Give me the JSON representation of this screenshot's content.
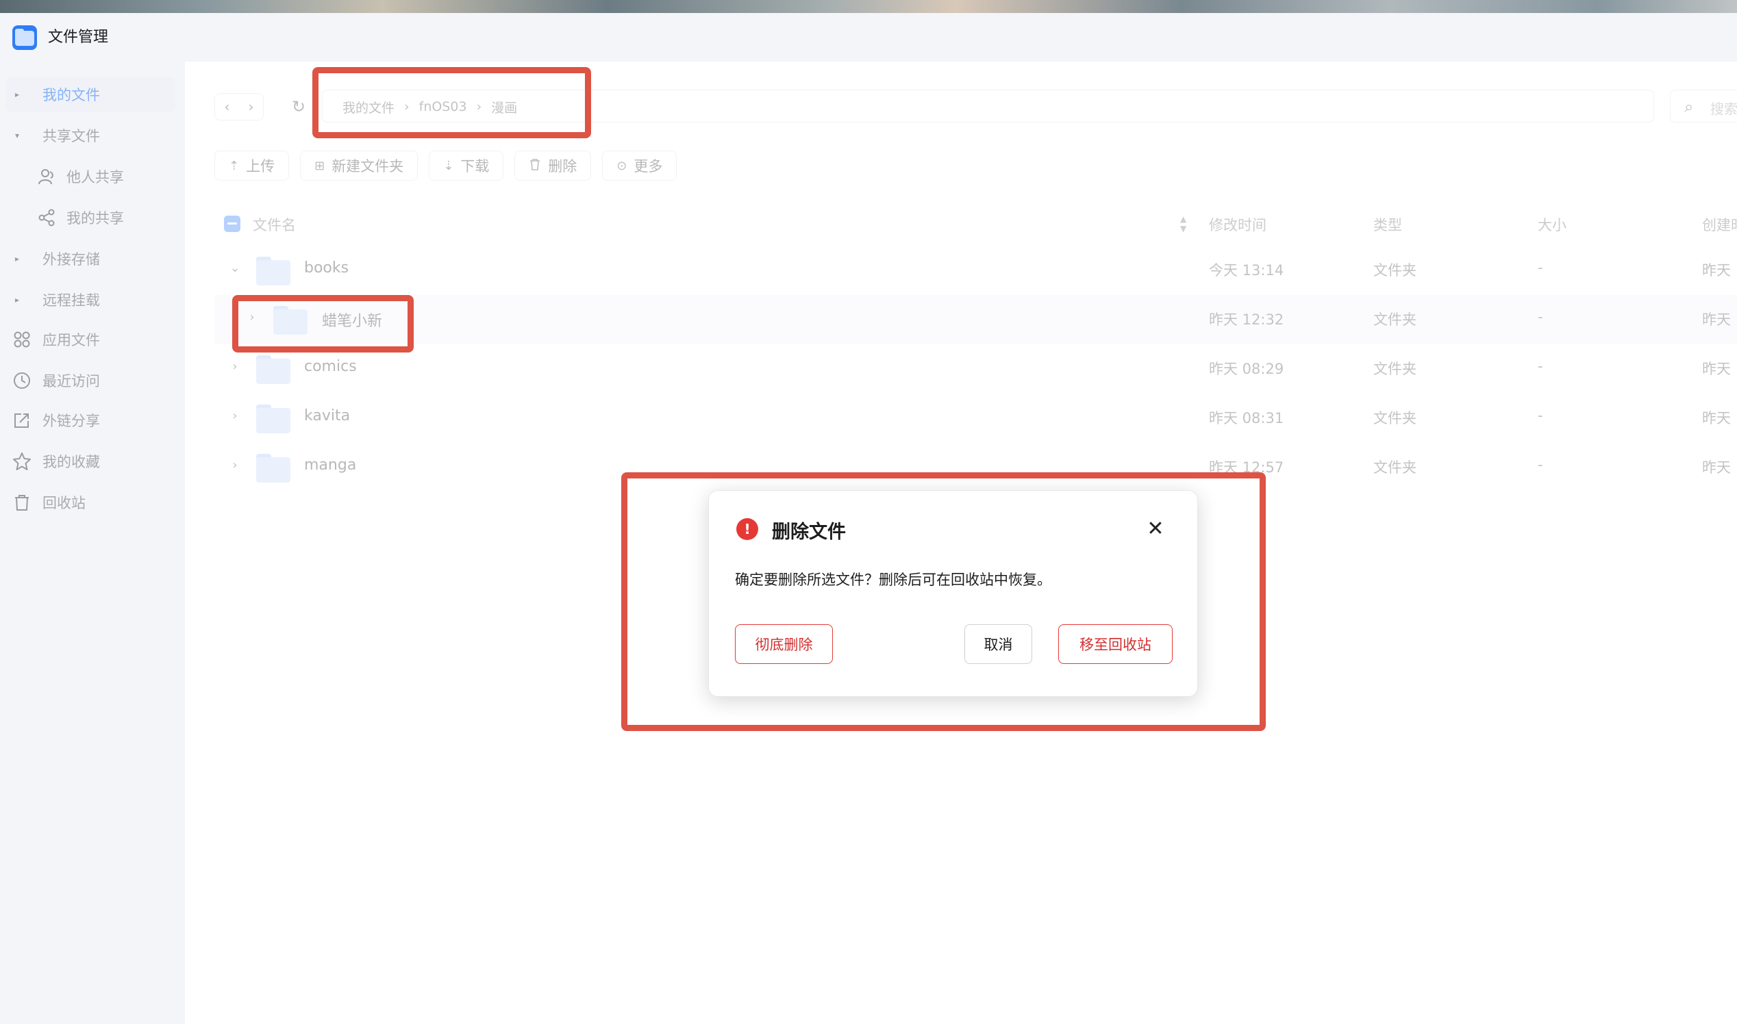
{
  "app": {
    "title": "文件管理",
    "accent_color": "#2f7df6",
    "icon": "folder-app-icon"
  },
  "sidebar": {
    "items": [
      {
        "label": "我的文件",
        "icon": "caret-right-icon",
        "active": true
      },
      {
        "label": "共享文件",
        "icon": "caret-down-icon"
      },
      {
        "label": "他人共享",
        "icon": "user-icon"
      },
      {
        "label": "我的共享",
        "icon": "share-icon"
      },
      {
        "label": "外接存储",
        "icon": "caret-right-icon"
      },
      {
        "label": "远程挂载",
        "icon": "caret-right-icon"
      },
      {
        "label": "应用文件",
        "icon": "grid-icon"
      },
      {
        "label": "最近访问",
        "icon": "clock-icon"
      },
      {
        "label": "外链分享",
        "icon": "external-share-icon"
      },
      {
        "label": "我的收藏",
        "icon": "star-icon"
      },
      {
        "label": "回收站",
        "icon": "trash-icon"
      }
    ]
  },
  "nav": {
    "back_glyph": "‹",
    "forward_glyph": "›",
    "refresh_glyph": "↻",
    "breadcrumb": [
      "我的文件",
      "fnOS03",
      "漫画"
    ],
    "breadcrumb_sep": "›",
    "search_placeholder": "搜索",
    "search_glyph": "⌕"
  },
  "toolbar": {
    "buttons": [
      {
        "label": "上传",
        "icon": "upload-icon",
        "glyph": "⇡"
      },
      {
        "label": "新建文件夹",
        "icon": "new-folder-icon",
        "glyph": "⊞"
      },
      {
        "label": "下载",
        "icon": "download-icon",
        "glyph": "⇣"
      },
      {
        "label": "删除",
        "icon": "trash-icon",
        "glyph": "🗑"
      },
      {
        "label": "更多",
        "icon": "more-icon",
        "glyph": "⊙"
      }
    ]
  },
  "table": {
    "headers": {
      "name": "文件名",
      "modified": "修改时间",
      "type": "类型",
      "size": "大小",
      "created": "创建时"
    },
    "rows": [
      {
        "name": "books",
        "modified": "今天 13:14",
        "type": "文件夹",
        "size": "-",
        "created": "昨天",
        "caret": "⌄"
      },
      {
        "name": "蜡笔小新",
        "modified": "昨天 12:32",
        "type": "文件夹",
        "size": "-",
        "created": "昨天",
        "caret": "›"
      },
      {
        "name": "comics",
        "modified": "昨天 08:29",
        "type": "文件夹",
        "size": "-",
        "created": "昨天",
        "caret": "›"
      },
      {
        "name": "kavita",
        "modified": "昨天 08:31",
        "type": "文件夹",
        "size": "-",
        "created": "昨天",
        "caret": "›"
      },
      {
        "name": "manga",
        "modified": "昨天 12:57",
        "type": "文件夹",
        "size": "-",
        "created": "昨天",
        "caret": "›"
      }
    ]
  },
  "dialog": {
    "title": "删除文件",
    "message": "确定要删除所选文件？删除后可在回收站中恢复。",
    "warn_glyph": "!",
    "close_glyph": "✕",
    "permanent_delete": "彻底删除",
    "cancel": "取消",
    "move_to_trash": "移至回收站",
    "danger_color": "#e53935"
  },
  "annotation_color": "#dd5344"
}
